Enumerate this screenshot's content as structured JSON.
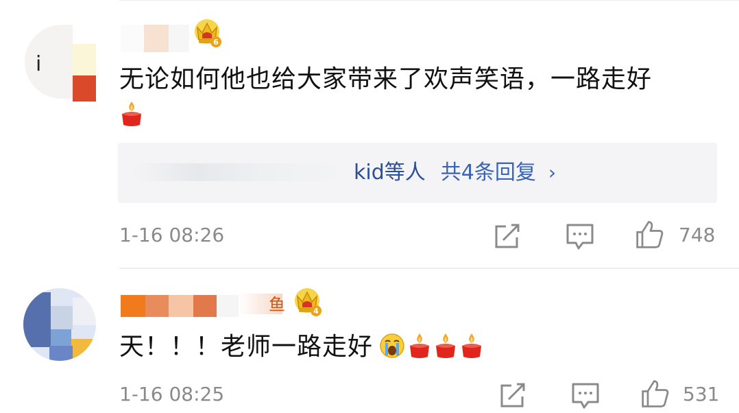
{
  "comments": [
    {
      "text": "无论如何他也给大家带来了欢声笑语，一路走好",
      "emoji": "candle-emoji",
      "crown_level": "6",
      "reply_preview": {
        "users": "kid等人",
        "count_label": "共4条回复"
      },
      "time": "1-16 08:26",
      "likes": "748",
      "avatar_letter": "i"
    },
    {
      "text": "天！！！老师一路走好",
      "emoji": [
        "crying-face-emoji",
        "candle-emoji",
        "candle-emoji",
        "candle-emoji"
      ],
      "crown_level": "4",
      "name_tail_char": "鱼",
      "time": "1-16 08:25",
      "likes": "531"
    }
  ],
  "colors": {
    "link": "#3a63b6",
    "meta_text": "#8a8a8a",
    "reply_bg": "#f4f4f6",
    "crown_gold": "#f0b81e"
  }
}
